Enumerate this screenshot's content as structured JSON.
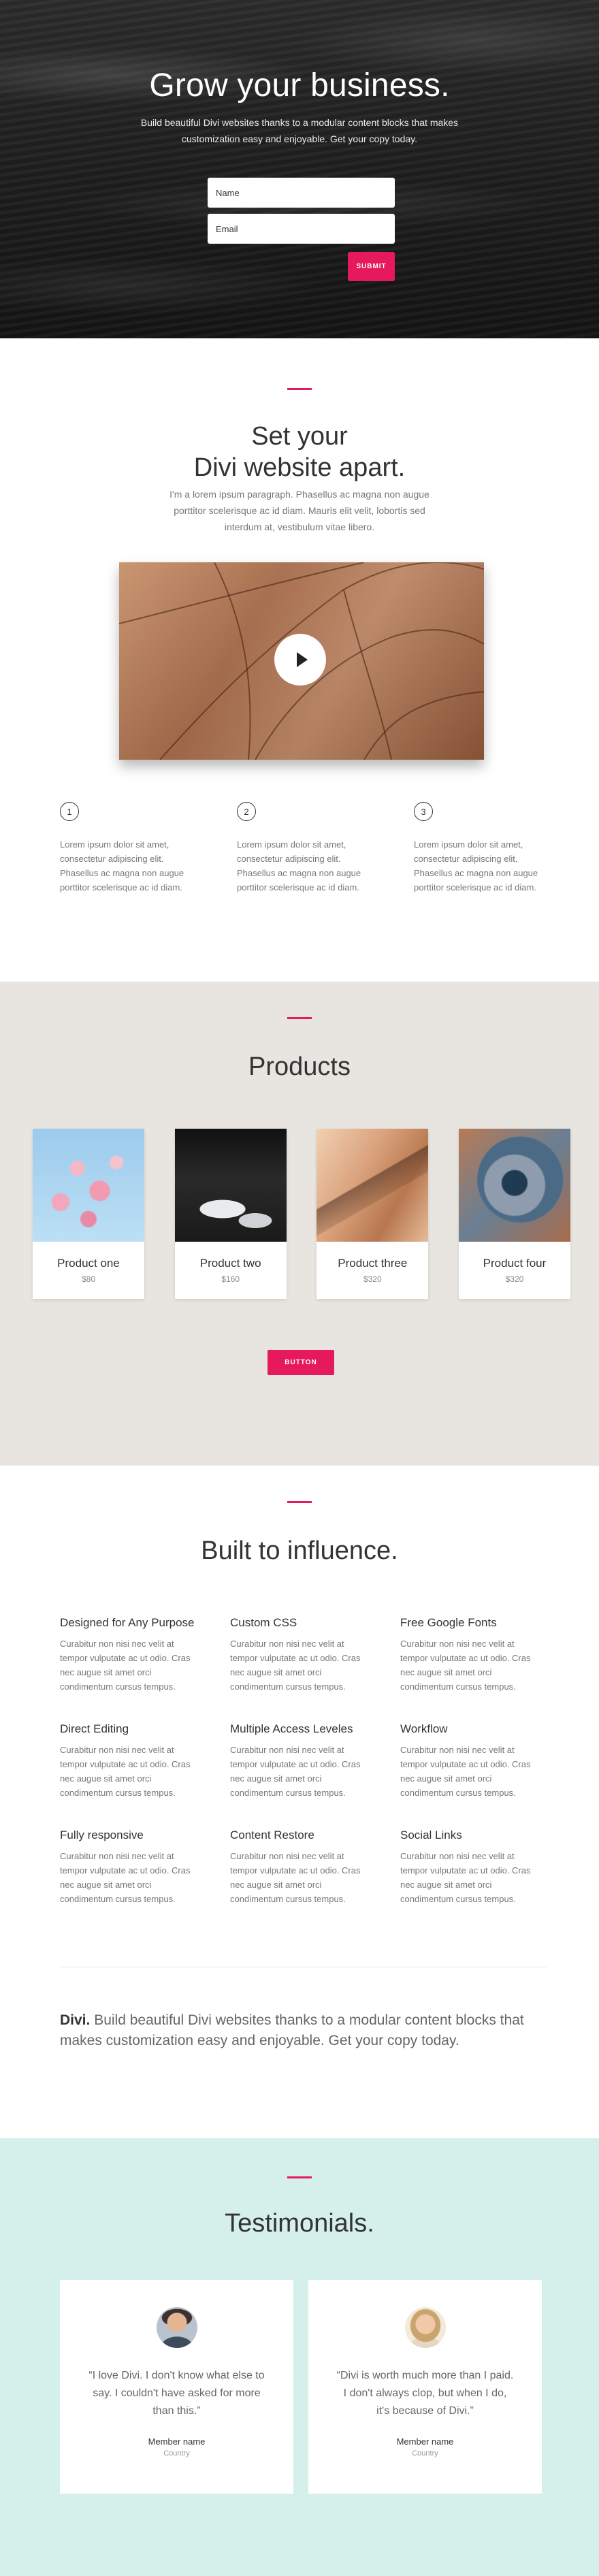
{
  "hero": {
    "title": "Grow your business.",
    "subtitle": "Build beautiful Divi websites thanks to a modular content blocks that makes customization easy and enjoyable. Get your copy today.",
    "name_placeholder": "Name",
    "email_placeholder": "Email",
    "submit_label": "SUBMIT"
  },
  "apart": {
    "title_line1": "Set your",
    "title_line2": "Divi website apart.",
    "lead": "I'm a lorem ipsum paragraph. Phasellus ac magna non augue porttitor scelerisque ac id diam. Mauris elit velit, lobortis sed interdum at, vestibulum vitae libero.",
    "video": {
      "play_icon": "play-icon"
    },
    "steps": [
      {
        "num": "1",
        "text": "Lorem ipsum dolor sit amet, consectetur adipiscing elit. Phasellus ac magna non augue porttitor scelerisque ac id diam."
      },
      {
        "num": "2",
        "text": "Lorem ipsum dolor sit amet, consectetur adipiscing elit. Phasellus ac magna non augue porttitor scelerisque ac id diam."
      },
      {
        "num": "3",
        "text": "Lorem ipsum dolor sit amet, consectetur adipiscing elit. Phasellus ac magna non augue porttitor scelerisque ac id diam."
      }
    ]
  },
  "products": {
    "title": "Products",
    "items": [
      {
        "name": "Product one",
        "price": "$80"
      },
      {
        "name": "Product two",
        "price": "$160"
      },
      {
        "name": "Product three",
        "price": "$320"
      },
      {
        "name": "Product four",
        "price": "$320"
      }
    ],
    "button_label": "BUTTON"
  },
  "features": {
    "title": "Built to influence.",
    "items": [
      {
        "title": "Designed for Any Purpose",
        "text": "Curabitur non nisi nec velit at tempor vulputate ac ut odio. Cras nec augue sit amet orci condimentum cursus tempus."
      },
      {
        "title": "Custom CSS",
        "text": "Curabitur non nisi nec velit at tempor vulputate ac ut odio. Cras nec augue sit amet orci condimentum cursus tempus."
      },
      {
        "title": "Free Google Fonts",
        "text": "Curabitur non nisi nec velit at tempor vulputate ac ut odio. Cras nec augue sit amet orci condimentum cursus tempus."
      },
      {
        "title": "Direct Editing",
        "text": "Curabitur non nisi nec velit at tempor vulputate ac ut odio. Cras nec augue sit amet orci condimentum cursus tempus."
      },
      {
        "title": "Multiple Access Leveles",
        "text": "Curabitur non nisi nec velit at tempor vulputate ac ut odio. Cras nec augue sit amet orci condimentum cursus tempus."
      },
      {
        "title": "Workflow",
        "text": "Curabitur non nisi nec velit at tempor vulputate ac ut odio. Cras nec augue sit amet orci condimentum cursus tempus."
      },
      {
        "title": "Fully responsive",
        "text": "Curabitur non nisi nec velit at tempor vulputate ac ut odio. Cras nec augue sit amet orci condimentum cursus tempus."
      },
      {
        "title": "Content Restore",
        "text": "Curabitur non nisi nec velit at tempor vulputate ac ut odio. Cras nec augue sit amet orci condimentum cursus tempus."
      },
      {
        "title": "Social Links",
        "text": "Curabitur non nisi nec velit at tempor vulputate ac ut odio. Cras nec augue sit amet orci condimentum cursus tempus."
      }
    ],
    "brand_name": "Divi.",
    "brand_text": "Build beautiful Divi websites thanks to a modular content blocks that makes customization easy and enjoyable. Get your copy today."
  },
  "testimonials": {
    "title": "Testimonials.",
    "items": [
      {
        "quote": "“I love Divi. I don't know what else to say. I couldn't have asked for more than this.”",
        "name": "Member name",
        "country": "Country"
      },
      {
        "quote": "“Divi is worth much more than I paid. I don't always clop, but when I do, it's because of Divi.”",
        "name": "Member name",
        "country": "Country"
      }
    ]
  },
  "colors": {
    "accent": "#e5195c",
    "products_bg": "#e8e5e0",
    "testimonials_bg": "#d5efea"
  }
}
